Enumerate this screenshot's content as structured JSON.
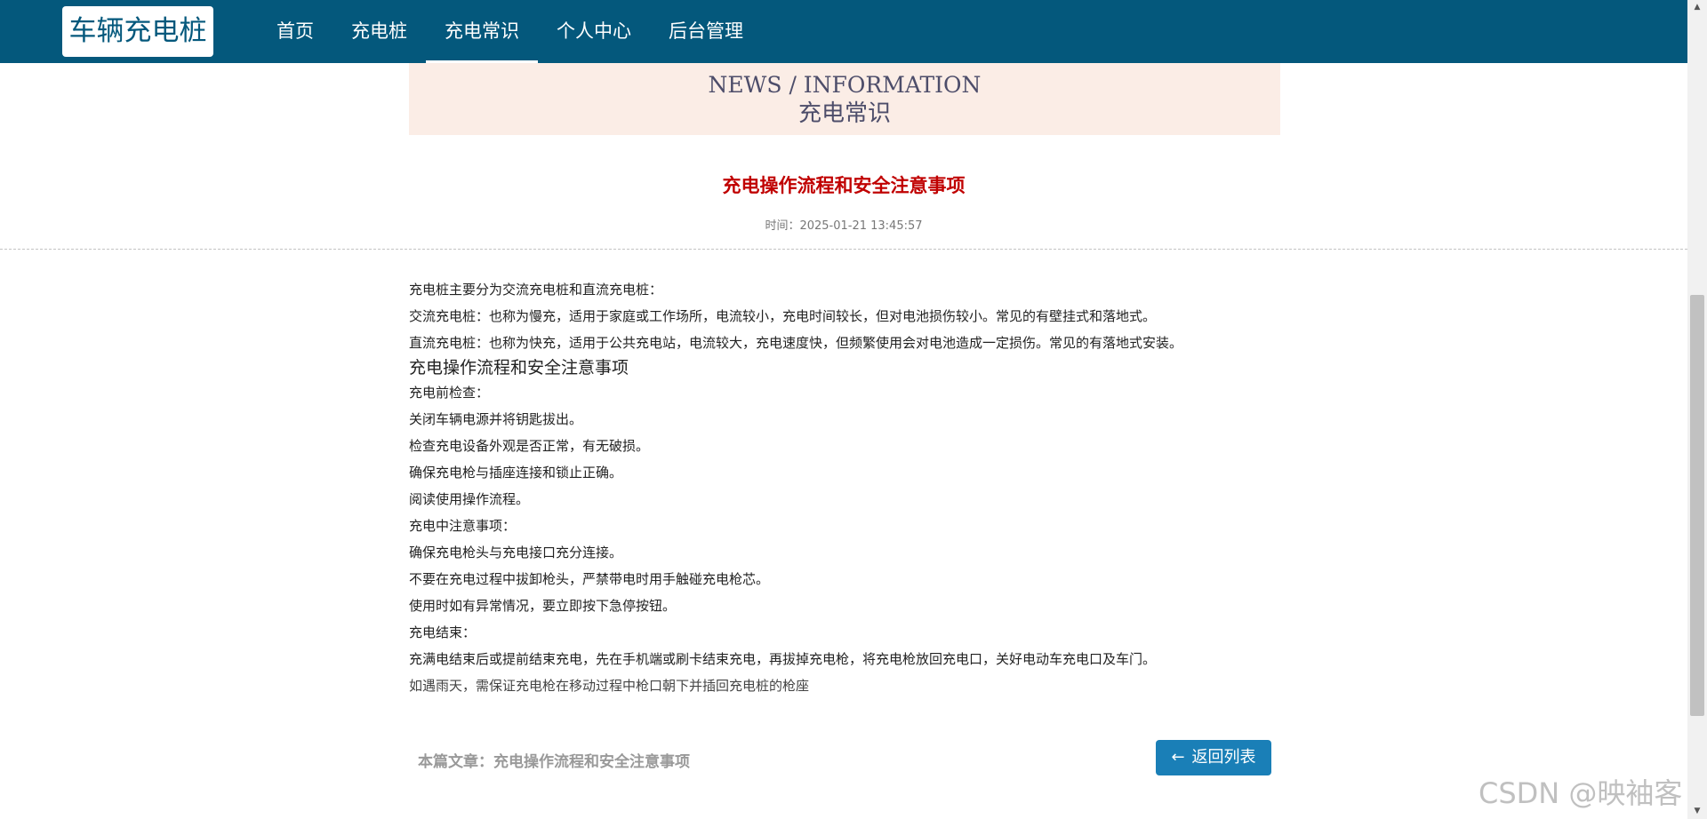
{
  "header": {
    "logo": "车辆充电桩",
    "nav": [
      {
        "label": "首页"
      },
      {
        "label": "充电桩"
      },
      {
        "label": "充电常识"
      },
      {
        "label": "个人中心"
      },
      {
        "label": "后台管理"
      }
    ]
  },
  "banner": {
    "en": "NEWS / INFORMATION",
    "cn": "充电常识"
  },
  "article": {
    "title": "充电操作流程和安全注意事项",
    "time": "时间：2025-01-21 13:45:57",
    "lines": [
      "充电桩主要分为交流充电桩和直流充电桩：",
      "交流充电桩：也称为慢充，适用于家庭或工作场所，电流较小，充电时间较长，但对电池损伤较小。常见的有壁挂式和落地式。",
      "直流充电桩：也称为快充，适用于公共充电站，电流较大，充电速度快，但频繁使用会对电池造成一定损伤。常见的有落地式安装。",
      "充电操作流程和安全注意事项",
      "充电前检查：",
      "关闭车辆电源并将钥匙拔出。",
      "检查充电设备外观是否正常，有无破损。",
      "确保充电枪与插座连接和锁止正确。",
      "阅读使用操作流程。",
      "充电中注意事项：",
      "确保充电枪头与充电接口充分连接。",
      "不要在充电过程中拔卸枪头，严禁带电时用手触碰充电枪芯。",
      "使用时如有异常情况，要立即按下急停按钮。",
      "充电结束：",
      "充满电结束后或提前结束充电，先在手机端或刷卡结束充电，再拔掉充电枪，将充电枪放回充电口，关好电动车充电口及车门。",
      "如遇雨天，需保证充电枪在移动过程中枪口朝下并插回充电桩的枪座"
    ]
  },
  "footer": {
    "current_label": "本篇文章：充电操作流程和安全注意事项",
    "back_button": "返回列表",
    "back_icon": "←"
  },
  "scrollbar": {
    "up": "▲",
    "down": "▼"
  },
  "watermark": "CSDN @映袖客"
}
